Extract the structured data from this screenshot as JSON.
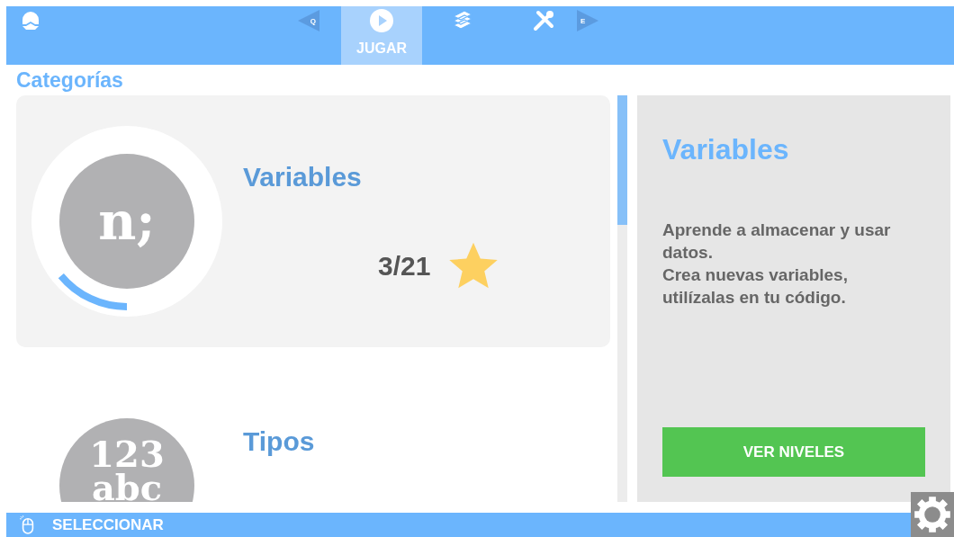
{
  "top_bar": {
    "prev_key": "Q",
    "next_key": "E",
    "tabs": [
      {
        "kind": "play",
        "label": "JUGAR",
        "selected": true
      },
      {
        "kind": "books",
        "selected": false
      },
      {
        "kind": "tools",
        "selected": false
      }
    ]
  },
  "heading": "Categorías",
  "categories": [
    {
      "icon_lines": [
        "n;"
      ],
      "title": "Variables",
      "progress": "3/21",
      "selected": true
    },
    {
      "icon_lines": [
        "123",
        "abc"
      ],
      "title": "Tipos",
      "selected": false
    }
  ],
  "details": {
    "title": "Variables",
    "description": [
      "Aprende a almacenar y usar datos.",
      "Crea nuevas variables, utilízalas en tu código."
    ],
    "button": "VER NIVELES"
  },
  "bottom_bar": {
    "hint": "SELECCIONAR"
  }
}
